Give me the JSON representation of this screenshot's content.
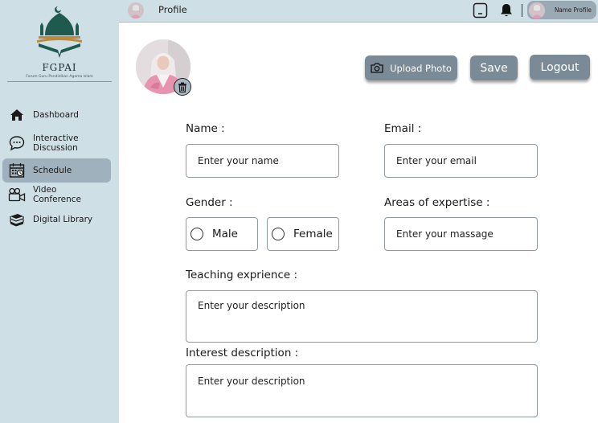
{
  "app": {
    "logo_title": "FGPAI",
    "logo_subtitle": "Forum Guru Pendidikan Agama Islam"
  },
  "sidebar": {
    "items": [
      {
        "label": "Dashboard",
        "icon": "home-icon",
        "active": false
      },
      {
        "label": "Interactive Discussion",
        "icon": "chat-icon",
        "active": false
      },
      {
        "label": "Schedule",
        "icon": "calendar-icon",
        "active": true
      },
      {
        "label": "Video Conference",
        "icon": "video-camera-icon",
        "active": false
      },
      {
        "label": "Digital Library",
        "icon": "books-icon",
        "active": false
      }
    ]
  },
  "header": {
    "title": "Profile",
    "profile_name": "Name Profile",
    "bookmark_icon": "bookmark-icon",
    "bell_icon": "bell-icon"
  },
  "actions": {
    "upload_photo": "Upload Photo",
    "save": "Save",
    "logout": "Logout"
  },
  "form": {
    "name": {
      "label": "Name :",
      "placeholder": "Enter your name"
    },
    "email": {
      "label": "Email :",
      "placeholder": "Enter your email"
    },
    "gender": {
      "label": "Gender :",
      "options": [
        "Male",
        "Female"
      ]
    },
    "expertise": {
      "label": "Areas of expertise :",
      "placeholder": "Enter your massage"
    },
    "teaching": {
      "label": "Teaching exprience :",
      "placeholder": "Enter your description"
    },
    "interest": {
      "label": "Interest description :",
      "placeholder": "Enter your description"
    }
  },
  "colors": {
    "sidebar_bg": "#cfdfe6",
    "active_item": "#9fb1bd",
    "button_bg": "#7a8a96",
    "logo_green": "#1f5a4e",
    "logo_gold": "#b98b3a"
  }
}
